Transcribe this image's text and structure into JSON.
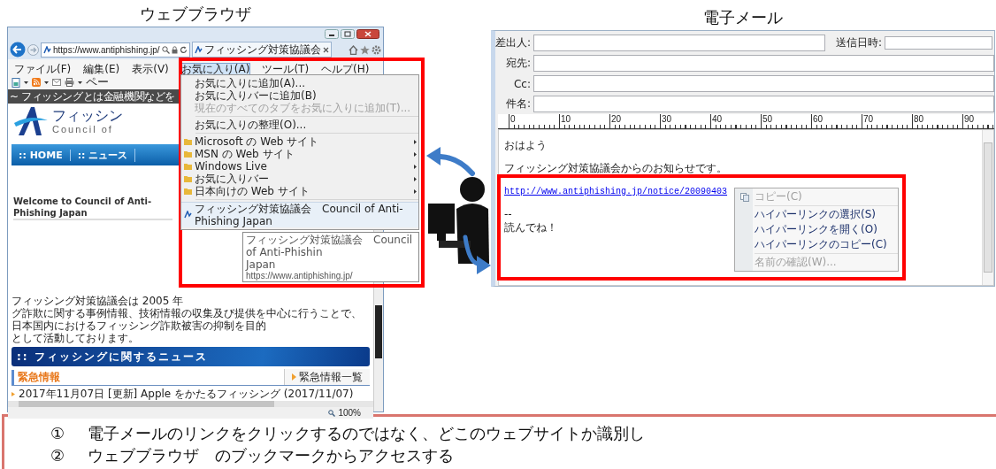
{
  "browser": {
    "caption": "ウェブブラウザ",
    "address": "https://www.antiphishing.jp/",
    "tab_title": "フィッシング対策協議会",
    "menu_bar": [
      {
        "label": "ファイル(F)",
        "selected": false
      },
      {
        "label": "編集(E)",
        "selected": false
      },
      {
        "label": "表示(V)",
        "selected": false
      },
      {
        "label": "お気に入り(A)",
        "selected": true
      },
      {
        "label": "ツール(T)",
        "selected": false
      },
      {
        "label": "ヘルプ(H)",
        "selected": false
      }
    ],
    "command_bar_text": "ペー",
    "banner_text": "~ フィッシングとは金融機関などを",
    "logo": {
      "title": "フィッシン",
      "subtitle": "Council of"
    },
    "nav": [
      ":: HOME",
      ":: ニュース"
    ],
    "heading": "Welcome to Council of Anti-Phishing Japan",
    "paragraph_lines": [
      "フィッシング対策協議会は 2005 年",
      "グ詐欺に関する事例情報、技術情報の収集及び提供を中心に行うことで、日本国内におけるフィッシング詐欺被害の抑制を目的",
      "として活動しております。"
    ],
    "news_banner": ":: フィッシングに関するニュース",
    "alert_heading": "緊急情報",
    "alert_link": "緊急情報一覧",
    "news_items": [
      "2017年11月07日 [更新] Apple をかたるフィッシング (2017/11/07)"
    ],
    "zoom": "100%",
    "favorites_menu": [
      [
        {
          "kind": "command",
          "label": "お気に入りに追加(A)...",
          "disabled": false
        },
        {
          "kind": "command",
          "label": "お気に入りバーに追加(B)",
          "disabled": false
        },
        {
          "kind": "command",
          "label": "現在のすべてのタブをお気に入りに追加(T)...",
          "disabled": true
        }
      ],
      [
        {
          "kind": "command",
          "label": "お気に入りの整理(O)...",
          "disabled": false
        }
      ],
      [
        {
          "kind": "folder",
          "label": "Microsoft の Web サイト",
          "disabled": false
        },
        {
          "kind": "folder",
          "label": "MSN の Web サイト",
          "disabled": false
        },
        {
          "kind": "folder",
          "label": "Windows Live",
          "disabled": false
        },
        {
          "kind": "folder",
          "label": "お気に入りバー",
          "disabled": false
        },
        {
          "kind": "folder",
          "label": "日本向けの Web サイト",
          "disabled": false
        }
      ],
      [
        {
          "kind": "site",
          "label": "フィッシング対策協議会　Council of Anti-Phishing Japan",
          "disabled": false
        }
      ]
    ],
    "tooltip_lines": [
      "フィッシング対策協議会　Council of Anti-Phishin",
      "Japan",
      "https://www.antiphishing.jp/"
    ]
  },
  "email": {
    "caption": "電子メール",
    "header_fields": [
      {
        "label": "差出人:"
      },
      {
        "label": "宛先:"
      },
      {
        "label": "Cc:"
      },
      {
        "label": "件名:"
      }
    ],
    "sent_label": "送信日時:",
    "ruler_marks": [
      "0",
      "10",
      "20",
      "30",
      "40",
      "50",
      "60",
      "70",
      "80",
      "90"
    ],
    "body_paragraphs": [
      [
        {
          "kind": "text",
          "text": "おはよう"
        }
      ],
      [
        {
          "kind": "text",
          "text": "フィッシング対策協議会からのお知らせです。"
        }
      ],
      [
        {
          "kind": "link",
          "text": "http://www.antiphishing.jp/notice/20090403"
        }
      ],
      [
        {
          "kind": "text",
          "text": "--"
        },
        {
          "kind": "text",
          "text": "読んでね！"
        }
      ]
    ],
    "context_menu": [
      [
        {
          "label": "コピー(C)",
          "disabled": true
        }
      ],
      [
        {
          "label": "ハイパーリンクの選択(S)",
          "disabled": false
        },
        {
          "label": "ハイパーリンクを開く(O)",
          "disabled": false
        },
        {
          "label": "ハイパーリンクのコピー(C)",
          "disabled": false
        }
      ],
      [
        {
          "label": "名前の確認(W)...",
          "disabled": true
        }
      ]
    ]
  },
  "notes": [
    {
      "number": "①",
      "text": "電子メールのリンクをクリックするのではなく、どこのウェブサイトか識別し"
    },
    {
      "number": "②",
      "text": "ウェブブラウザ　のブックマークからアクセスする"
    }
  ]
}
